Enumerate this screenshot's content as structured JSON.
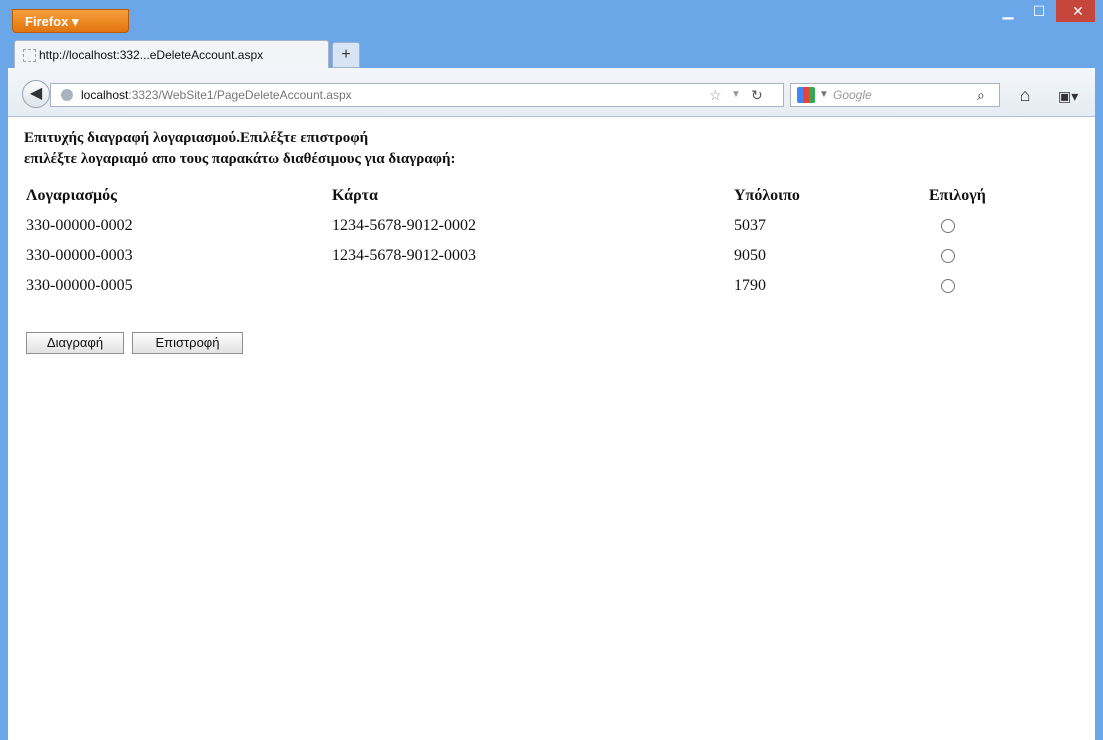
{
  "browser": {
    "menu_label": "Firefox",
    "tab_title": "http://localhost:332...eDeleteAccount.aspx",
    "new_tab": "+",
    "url_host": "localhost",
    "url_rest": ":3323/WebSite1/PageDeleteAccount.aspx",
    "search_placeholder": "Google"
  },
  "page": {
    "success_message": "Επιτυχής διαγραφή λογαριασμού.Επιλέξτε επιστροφή",
    "instruction": "επιλέξτε λογαριαμό απο τους παρακάτω διαθέσιμους για διαγραφή:",
    "table": {
      "headers": [
        "Λογαριασμός",
        "Κάρτα",
        "Υπόλοιπο",
        "Επιλογή"
      ],
      "rows": [
        {
          "account": "330-00000-0002",
          "card": "1234-5678-9012-0002",
          "balance": "5037"
        },
        {
          "account": "330-00000-0003",
          "card": "1234-5678-9012-0003",
          "balance": "9050"
        },
        {
          "account": "330-00000-0005",
          "card": "",
          "balance": "1790"
        }
      ]
    },
    "buttons": {
      "delete": "Διαγραφή",
      "return": "Επιστροφή"
    }
  }
}
